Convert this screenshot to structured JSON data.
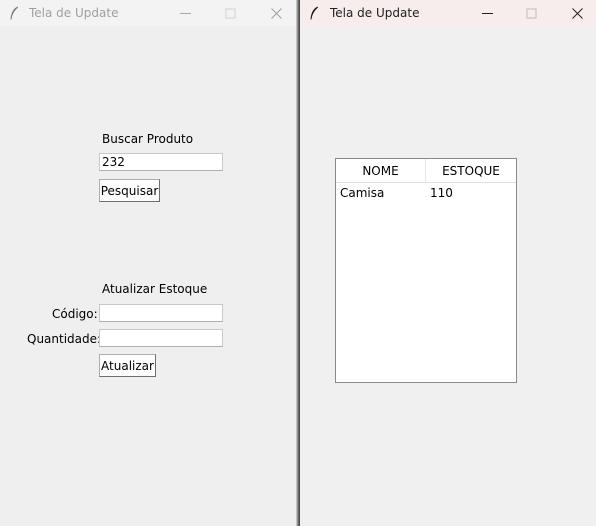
{
  "left_window": {
    "title": "Tela de Update",
    "search": {
      "label": "Buscar Produto",
      "input_value": "232",
      "button_label": "Pesquisar"
    },
    "update": {
      "label": "Atualizar Estoque",
      "codigo_label": "Código:",
      "codigo_value": "",
      "quantidade_label": "Quantidade:",
      "quantidade_value": "",
      "button_label": "Atualizar"
    }
  },
  "right_window": {
    "title": "Tela de Update",
    "table": {
      "columns": [
        "NOME",
        "ESTOQUE"
      ],
      "rows": [
        [
          "Camisa",
          "110"
        ]
      ]
    }
  },
  "icons": {
    "app_icon": "feather-icon",
    "minimize": "minimize-icon",
    "maximize": "maximize-icon",
    "close": "close-icon"
  }
}
